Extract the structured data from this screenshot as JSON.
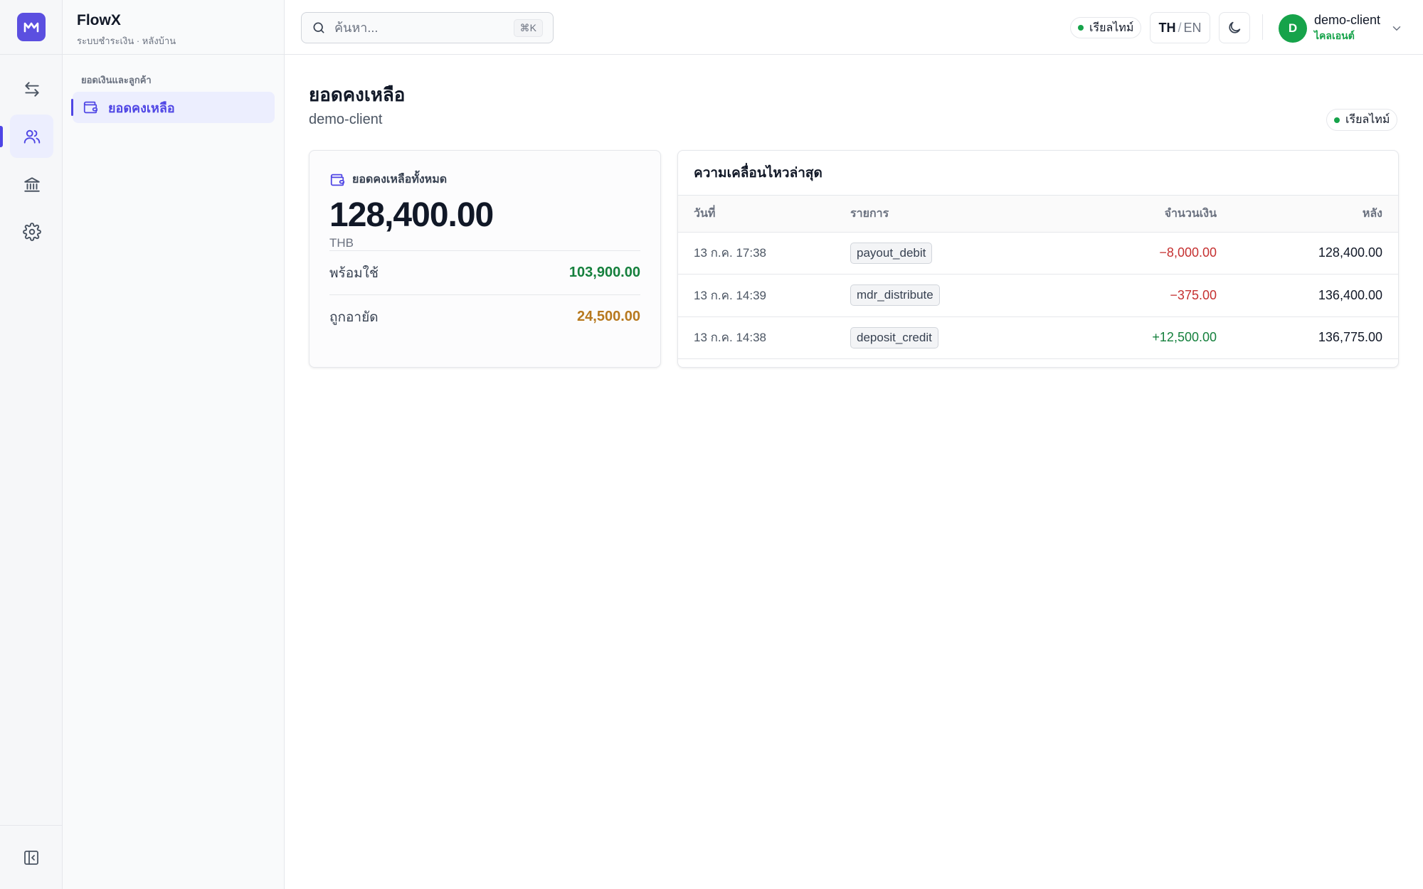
{
  "app": {
    "name": "FlowX",
    "subtitle": "ระบบชำระเงิน · หลังบ้าน"
  },
  "rail": {
    "items": [
      {
        "icon": "transfer-arrows-icon",
        "active": false
      },
      {
        "icon": "users-icon",
        "active": true
      },
      {
        "icon": "bank-icon",
        "active": false
      },
      {
        "icon": "settings-gear-icon",
        "active": false
      }
    ],
    "collapse_icon": "sidebar-collapse-icon"
  },
  "sidebar": {
    "section_label": "ยอดเงินและลูกค้า",
    "items": [
      {
        "label": "ยอดคงเหลือ",
        "icon": "wallet-icon",
        "active": true
      }
    ]
  },
  "topbar": {
    "search_placeholder": "ค้นหา...",
    "search_shortcut": "⌘K",
    "realtime_label": "เรียลไทม์",
    "lang_active": "TH",
    "lang_sep": "/",
    "lang_other": "EN",
    "theme_icon": "moon-icon",
    "user": {
      "initial": "D",
      "name": "demo-client",
      "role": "ไคลเอนต์"
    }
  },
  "page": {
    "title": "ยอดคงเหลือ",
    "subtitle": "demo-client",
    "realtime_label": "เรียลไทม์"
  },
  "balance_card": {
    "title": "ยอดคงเหลือทั้งหมด",
    "total": "128,400.00",
    "currency": "THB",
    "rows": [
      {
        "label": "พร้อมใช้",
        "value": "103,900.00",
        "color": "#15803d"
      },
      {
        "label": "ถูกอายัด",
        "value": "24,500.00",
        "color": "#b7791f"
      }
    ]
  },
  "movements": {
    "title": "ความเคลื่อนไหวล่าสุด",
    "columns": [
      "วันที่",
      "รายการ",
      "จำนวนเงิน",
      "หลัง"
    ],
    "rows": [
      {
        "date": "13 ก.ค. 17:38",
        "type": "payout_debit",
        "amount": "−8,000.00",
        "after": "128,400.00",
        "sign": "neg"
      },
      {
        "date": "13 ก.ค. 14:39",
        "type": "mdr_distribute",
        "amount": "−375.00",
        "after": "136,400.00",
        "sign": "neg"
      },
      {
        "date": "13 ก.ค. 14:38",
        "type": "deposit_credit",
        "amount": "+12,500.00",
        "after": "136,775.00",
        "sign": "pos"
      }
    ]
  },
  "colors": {
    "accent": "#4f46e5",
    "positive": "#15803d",
    "negative": "#c53030",
    "held": "#b7791f",
    "status_online": "#16a34a"
  }
}
